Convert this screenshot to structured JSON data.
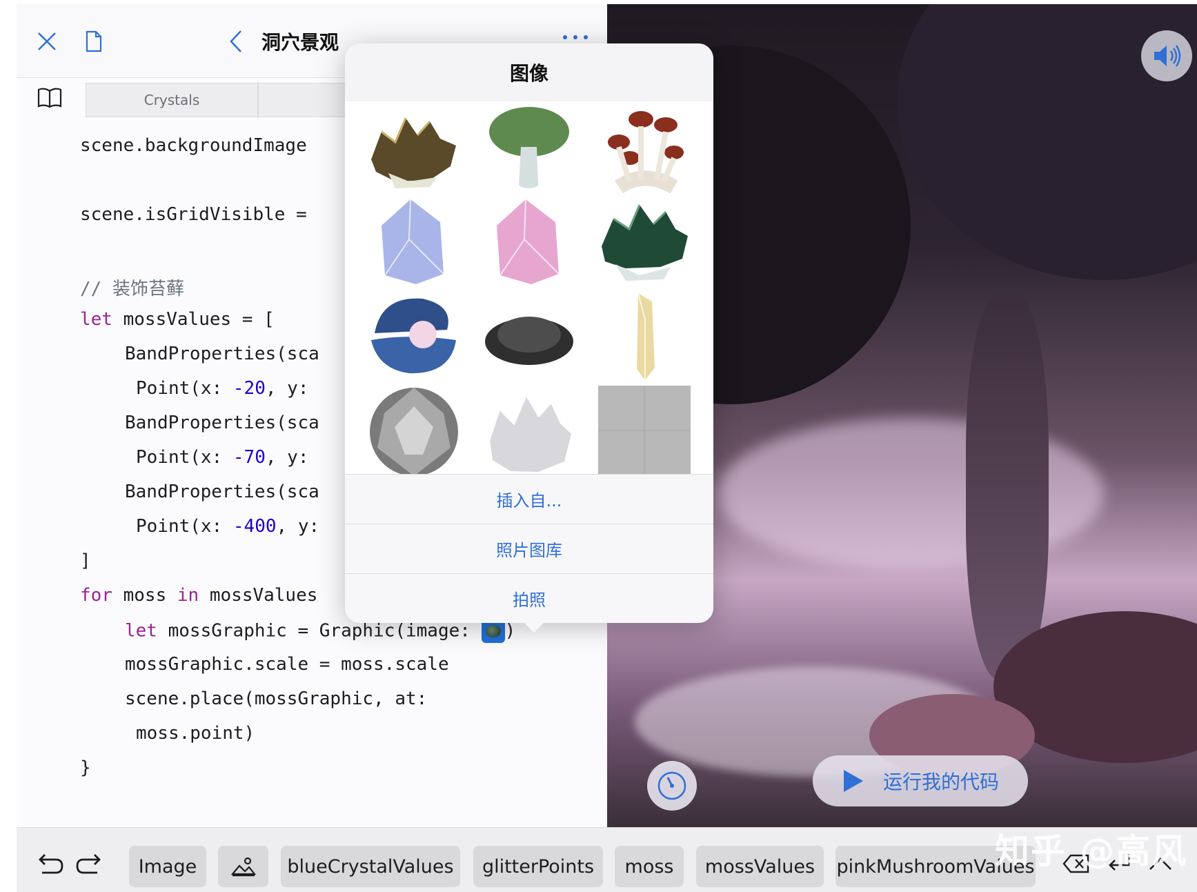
{
  "header": {
    "title": "洞穴景观"
  },
  "tabs": [
    {
      "label": "Crystals"
    }
  ],
  "code": {
    "l1": "scene.backgroundImage",
    "l2": "scene.isGridVisible =",
    "l3": "// 装饰苔藓",
    "l4_kw": "let",
    "l4_rest": " mossValues = [",
    "l5": "BandProperties(sca",
    "l6_a": "Point(x: ",
    "l6_num": "-20",
    "l6_b": ", y:",
    "l7": "BandProperties(sca",
    "l8_a": "Point(x: ",
    "l8_num": "-70",
    "l8_b": ", y:",
    "l9": "BandProperties(sca",
    "l10_a": "Point(x: ",
    "l10_num": "-400",
    "l10_b": ", y:",
    "l11": "]",
    "l12_kw1": "for",
    "l12_mid": " moss ",
    "l12_kw2": "in",
    "l12_rest": " mossValues",
    "l13_kw": "let",
    "l13_rest": " mossGraphic = Graphic(image: ",
    "l13_end": ")",
    "l14": "mossGraphic.scale = moss.scale",
    "l15": "scene.place(mossGraphic, at:",
    "l16": "moss.point)",
    "l17": "}"
  },
  "popover": {
    "title": "图像",
    "images": [
      "smoky-crystal-cluster",
      "green-mushroom",
      "red-mushroom-cluster",
      "blue-crystal",
      "pink-crystal",
      "green-crystal-cluster",
      "pearl-shell",
      "moss-clump",
      "yellow-crystal-shard",
      "grey-gem",
      "white-crystal-cluster",
      "grid-placeholder"
    ],
    "actions": [
      "插入自...",
      "照片图库",
      "拍照"
    ]
  },
  "scene": {
    "run_label": "运行我的代码"
  },
  "bottombar": {
    "chips": [
      "Image",
      "blueCrystalValues",
      "glitterPoints",
      "moss",
      "mossValues",
      "pinkMushroomValues"
    ]
  },
  "watermark": "知乎 @高风",
  "colors": {
    "accent": "#2f6fd6",
    "keyword": "#9b2393",
    "number": "#1c00cf"
  }
}
